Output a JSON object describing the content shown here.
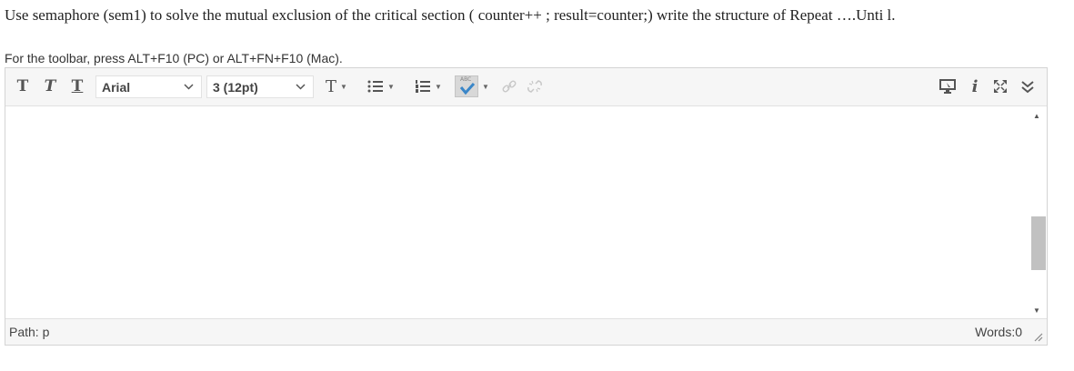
{
  "question": {
    "text": "Use semaphore (sem1) to solve the mutual exclusion of the critical section ( counter++ ; result=counter;) write the structure of Repeat ….Unti l."
  },
  "toolbar_hint": "For the toolbar, press ALT+F10 (PC) or ALT+FN+F10 (Mac).",
  "toolbar": {
    "font_family": "Arial",
    "font_size": "3 (12pt)",
    "spellcheck_label": "ABC"
  },
  "editor": {
    "content": ""
  },
  "statusbar": {
    "path": "Path: p",
    "words": "Words:0"
  }
}
